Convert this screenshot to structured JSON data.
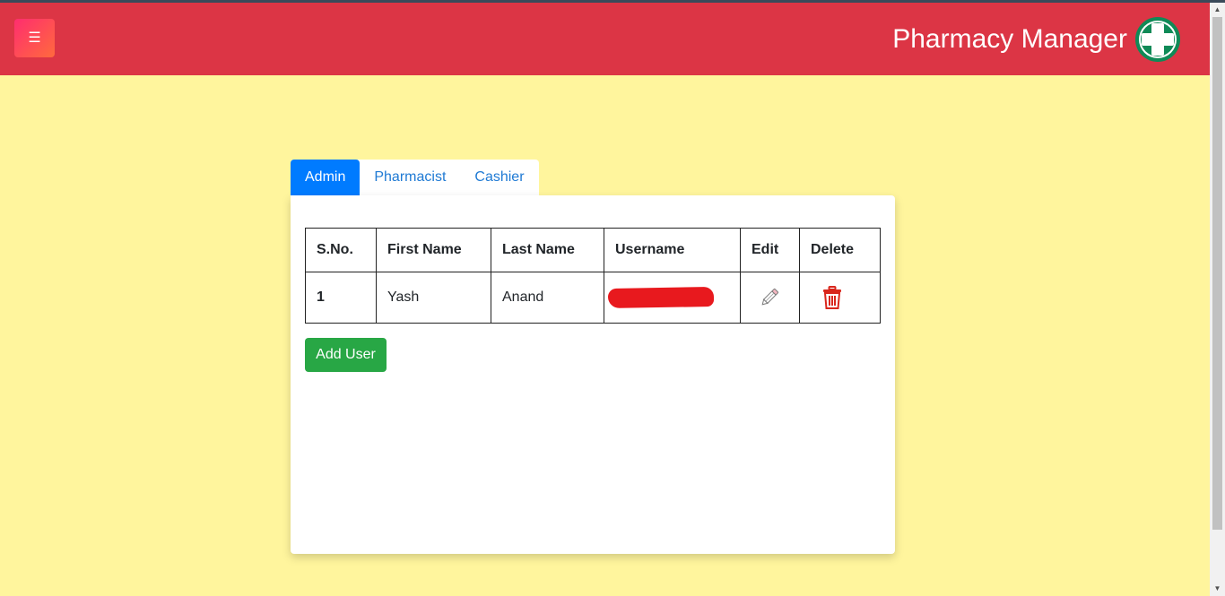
{
  "header": {
    "menu_glyph": "☰",
    "title": "Pharmacy Manager",
    "colors": {
      "bar": "#dc3545",
      "logo": "#0f8a57"
    }
  },
  "tabs": [
    {
      "label": "Admin",
      "active": true
    },
    {
      "label": "Pharmacist",
      "active": false
    },
    {
      "label": "Cashier",
      "active": false
    }
  ],
  "table": {
    "columns": [
      "S.No.",
      "First Name",
      "Last Name",
      "Username",
      "Edit",
      "Delete"
    ],
    "rows": [
      {
        "sno": "1",
        "first_name": "Yash",
        "last_name": "Anand",
        "username": "",
        "edit_icon": "pencil-icon",
        "delete_icon": "trash-icon"
      }
    ]
  },
  "actions": {
    "add_user_label": "Add User",
    "add_user_color": "#28a745"
  },
  "theme": {
    "page_background": "#fff59d",
    "active_tab": "#007bff"
  }
}
